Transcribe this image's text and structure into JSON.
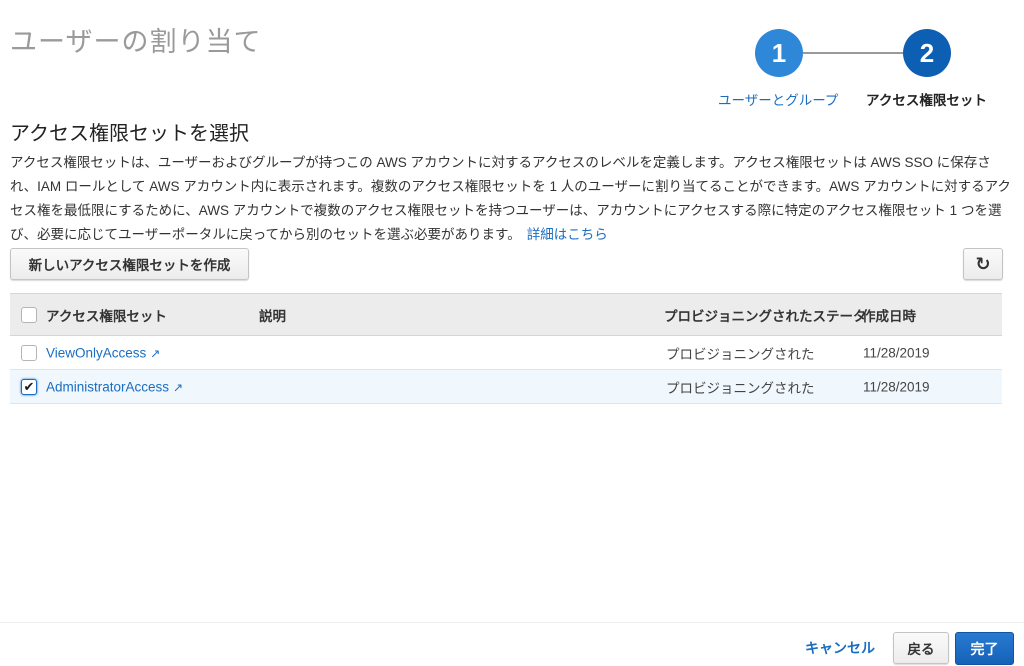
{
  "page_title": "ユーザーの割り当て",
  "steps": [
    {
      "number": "1",
      "label": "ユーザーとグループ"
    },
    {
      "number": "2",
      "label": "アクセス権限セット"
    }
  ],
  "section_title": "アクセス権限セットを選択",
  "description": "アクセス権限セットは、ユーザーおよびグループが持つこの AWS アカウントに対するアクセスのレベルを定義します。アクセス権限セットは AWS SSO に保存され、IAM ロールとして AWS アカウント内に表示されます。複数のアクセス権限セットを 1 人のユーザーに割り当てることができます。AWS アカウントに対するアクセス権を最低限にするために、AWS アカウントで複数のアクセス権限セットを持つユーザーは、アカウントにアクセスする際に特定のアクセス権限セット 1 つを選び、必要に応じてユーザーポータルに戻ってから別のセットを選ぶ必要があります。",
  "learn_more": "詳細はこちら",
  "create_button": "新しいアクセス権限セットを作成",
  "refresh_icon": "↻",
  "table": {
    "headers": {
      "name": "アクセス権限セット",
      "description": "説明",
      "status": "プロビジョニングされたステータス",
      "created": "作成日時"
    },
    "rows": [
      {
        "name": "ViewOnlyAccess",
        "description": "",
        "status": "プロビジョニングされた",
        "created": "11/28/2019",
        "checked": false
      },
      {
        "name": "AdministratorAccess",
        "description": "",
        "status": "プロビジョニングされた",
        "created": "11/28/2019",
        "checked": true
      }
    ]
  },
  "footer": {
    "cancel": "キャンセル",
    "back": "戻る",
    "done": "完了"
  },
  "colors": {
    "accent": "#1a6dc1",
    "primary_button": "#1462b8"
  }
}
